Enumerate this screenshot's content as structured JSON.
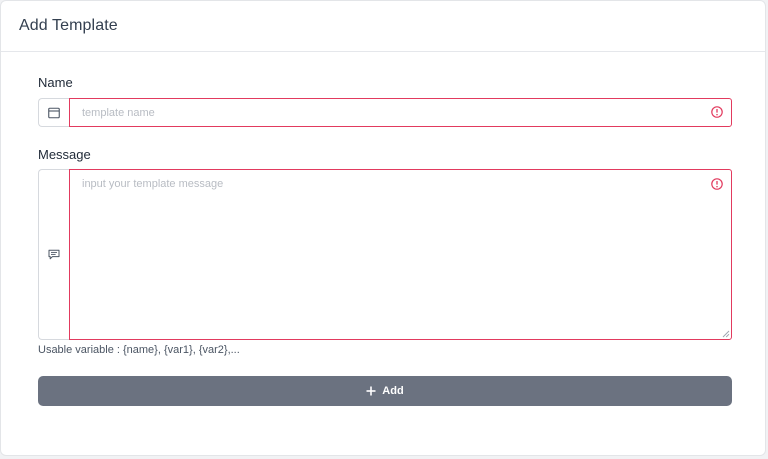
{
  "header": {
    "title": "Add Template"
  },
  "form": {
    "name": {
      "label": "Name",
      "placeholder": "template name",
      "value": "",
      "icon": "calendar-icon"
    },
    "message": {
      "label": "Message",
      "placeholder": "input your template message",
      "value": "",
      "icon": "message-icon"
    },
    "help_text": "Usable variable : {name}, {var1}, {var2},..."
  },
  "actions": {
    "add_label": "Add"
  },
  "colors": {
    "error": "#e23a5e",
    "button": "#6b7280",
    "title": "#344050"
  }
}
